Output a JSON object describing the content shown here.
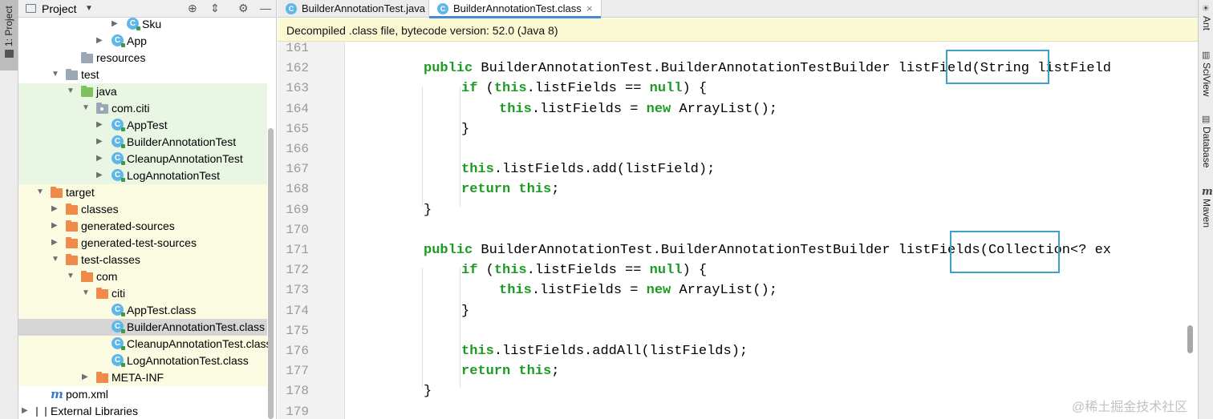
{
  "left_strip": {
    "tab_label": "1: Project"
  },
  "project_panel": {
    "title": "Project",
    "tree": [
      {
        "label": "Sku",
        "icon": "class-icon"
      },
      {
        "label": "App",
        "icon": "class-icon"
      },
      {
        "label": "resources",
        "icon": "folder-resources-icon"
      },
      {
        "label": "test",
        "icon": "folder-icon"
      },
      {
        "label": "java",
        "icon": "folder-test-source-icon"
      },
      {
        "label": "com.citi",
        "icon": "package-icon"
      },
      {
        "label": "AppTest",
        "icon": "class-icon"
      },
      {
        "label": "BuilderAnnotationTest",
        "icon": "class-icon"
      },
      {
        "label": "CleanupAnnotationTest",
        "icon": "class-icon"
      },
      {
        "label": "LogAnnotationTest",
        "icon": "class-icon"
      },
      {
        "label": "target",
        "icon": "folder-excluded-icon"
      },
      {
        "label": "classes",
        "icon": "folder-excluded-icon"
      },
      {
        "label": "generated-sources",
        "icon": "folder-excluded-icon"
      },
      {
        "label": "generated-test-sources",
        "icon": "folder-excluded-icon"
      },
      {
        "label": "test-classes",
        "icon": "folder-excluded-icon"
      },
      {
        "label": "com",
        "icon": "folder-excluded-icon"
      },
      {
        "label": "citi",
        "icon": "folder-excluded-icon"
      },
      {
        "label": "AppTest.class",
        "icon": "class-file-icon"
      },
      {
        "label": "BuilderAnnotationTest.class",
        "icon": "class-file-icon"
      },
      {
        "label": "CleanupAnnotationTest.class",
        "icon": "class-file-icon"
      },
      {
        "label": "LogAnnotationTest.class",
        "icon": "class-file-icon"
      },
      {
        "label": "META-INF",
        "icon": "folder-excluded-icon"
      },
      {
        "label": "pom.xml",
        "icon": "maven-icon"
      },
      {
        "label": "External Libraries",
        "icon": "libraries-icon"
      }
    ]
  },
  "tabs": [
    {
      "label": "BuilderAnnotationTest.java",
      "icon_letter": "C"
    },
    {
      "label": "BuilderAnnotationTest.class",
      "icon_letter": "C",
      "close": "×"
    }
  ],
  "banner": "Decompiled .class file, bytecode version: 52.0 (Java 8)",
  "code": {
    "line_numbers": [
      "161",
      "162",
      "163",
      "164",
      "165",
      "166",
      "167",
      "168",
      "169",
      "170",
      "171",
      "172",
      "173",
      "174",
      "175",
      "176",
      "177",
      "178",
      "179"
    ],
    "lines": [
      {
        "text": ""
      },
      {
        "kw": "public",
        "rest": " BuilderAnnotationTest.BuilderAnnotationTestBuilder listField(String listField"
      },
      {
        "kw": "if",
        "rest": " (this.listFields == null) {",
        "kw2": [
          "this",
          "null"
        ]
      },
      {
        "kw": "this",
        "rest": ".listFields = new ArrayList();"
      },
      {
        "text": "}"
      },
      {
        "text": ""
      },
      {
        "kw": "this",
        "rest": ".listFields.add(listField);"
      },
      {
        "kw": "return",
        "rest": " this;"
      },
      {
        "text": "}"
      },
      {
        "text": ""
      },
      {
        "kw": "public",
        "rest": " BuilderAnnotationTest.BuilderAnnotationTestBuilder listFields(Collection<? ex"
      },
      {
        "kw": "if",
        "rest": " (this.listFields == null) {"
      },
      {
        "kw": "this",
        "rest": ".listFields = new ArrayList();"
      },
      {
        "text": "}"
      },
      {
        "text": ""
      },
      {
        "kw": "this",
        "rest": ".listFields.addAll(listFields);"
      },
      {
        "kw": "return",
        "rest": " this;"
      },
      {
        "text": "}"
      },
      {
        "text": ""
      }
    ]
  },
  "right_strip": [
    "Ant",
    "SciView",
    "Database",
    "Maven"
  ],
  "watermark": "@稀土掘金技术社区",
  "colors": {
    "keyword": "#1c9b23",
    "highlight_box": "#3ea1c9",
    "banner_bg": "#fbf9d4"
  }
}
